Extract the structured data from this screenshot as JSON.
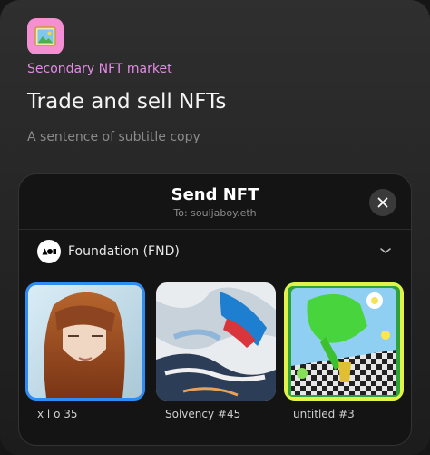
{
  "header": {
    "icon": "picture-icon",
    "eyebrow": "Secondary NFT market",
    "title": "Trade and sell NFTs",
    "subtitle": "A sentence of subtitle copy"
  },
  "modal": {
    "title": "Send NFT",
    "recipient": "To: souljaboy.eth",
    "close_icon": "close-icon",
    "collection": {
      "logo": "foundation-logo",
      "name": "Foundation (FND)",
      "chevron": "chevron-down-icon"
    },
    "nfts": [
      {
        "label": "x l o 35",
        "selected": true
      },
      {
        "label": "Solvency #45",
        "selected": false
      },
      {
        "label": "untitled #3",
        "selected": false
      }
    ]
  },
  "colors": {
    "accent_pink": "#e58be8",
    "icon_bg": "#f48fd1",
    "selection_blue": "#2f8cf2"
  }
}
